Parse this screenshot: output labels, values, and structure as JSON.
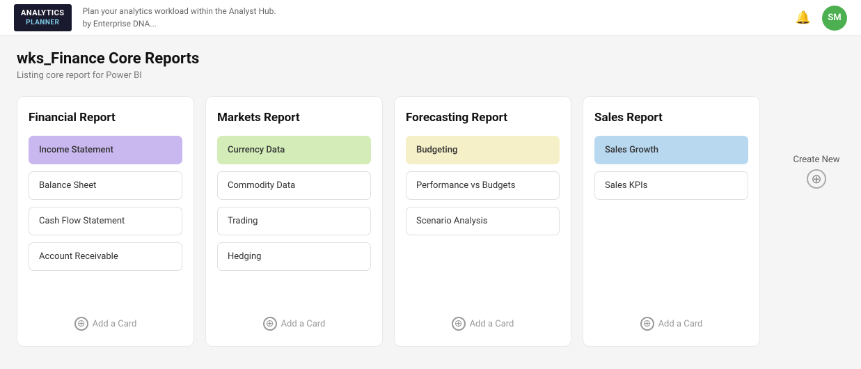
{
  "header": {
    "logo_top": "ANALYTICS",
    "logo_bottom": "PLANNER",
    "subtitle_line1": "Plan your analytics workload within the Analyst Hub.",
    "subtitle_line2": "by Enterprise DNA...",
    "avatar_initials": "SM"
  },
  "page": {
    "title": "wks_Finance Core Reports",
    "subtitle": "Listing core report for Power BI"
  },
  "sidebar": {
    "create_new_label": "Create New"
  },
  "reports": [
    {
      "id": "financial",
      "title": "Financial Report",
      "items": [
        {
          "label": "Income Statement",
          "highlight": "purple"
        },
        {
          "label": "Balance Sheet",
          "highlight": ""
        },
        {
          "label": "Cash Flow Statement",
          "highlight": ""
        },
        {
          "label": "Account Receivable",
          "highlight": ""
        }
      ],
      "add_label": "Add a Card"
    },
    {
      "id": "markets",
      "title": "Markets Report",
      "items": [
        {
          "label": "Currency Data",
          "highlight": "green"
        },
        {
          "label": "Commodity Data",
          "highlight": ""
        },
        {
          "label": "Trading",
          "highlight": ""
        },
        {
          "label": "Hedging",
          "highlight": ""
        }
      ],
      "add_label": "Add a Card"
    },
    {
      "id": "forecasting",
      "title": "Forecasting Report",
      "items": [
        {
          "label": "Budgeting",
          "highlight": "yellow"
        },
        {
          "label": "Performance vs Budgets",
          "highlight": ""
        },
        {
          "label": "Scenario Analysis",
          "highlight": ""
        }
      ],
      "add_label": "Add a Card"
    },
    {
      "id": "sales",
      "title": "Sales Report",
      "items": [
        {
          "label": "Sales Growth",
          "highlight": "blue"
        },
        {
          "label": "Sales KPIs",
          "highlight": ""
        }
      ],
      "add_label": "Add a Card"
    }
  ]
}
